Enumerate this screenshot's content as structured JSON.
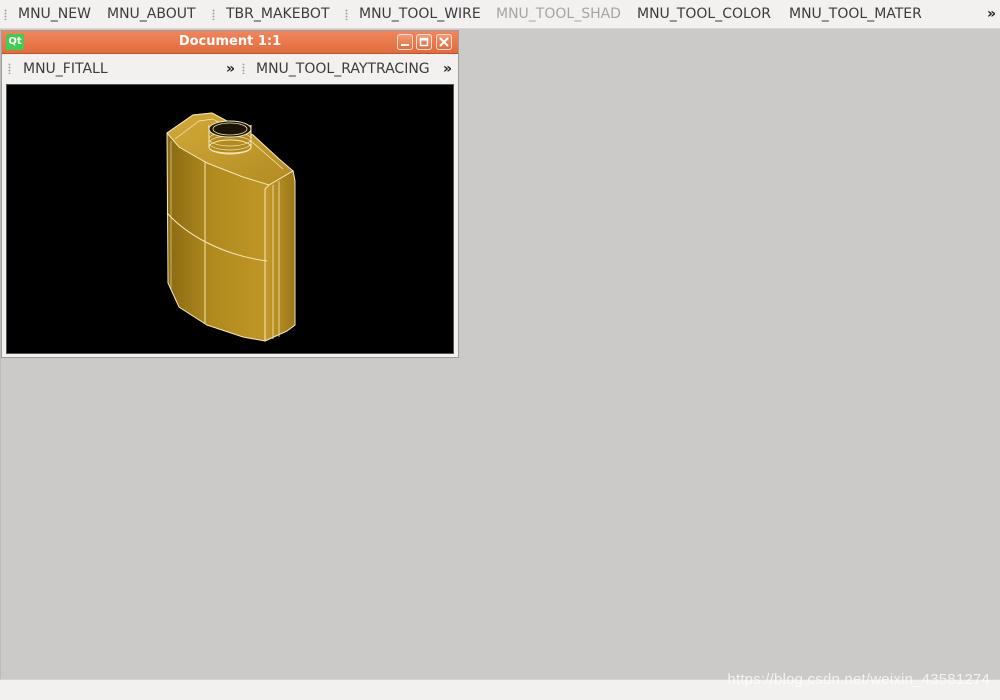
{
  "main_toolbar": {
    "items": [
      {
        "label": "MNU_NEW",
        "enabled": true
      },
      {
        "label": "MNU_ABOUT",
        "enabled": true
      },
      {
        "label": "TBR_MAKEBOT",
        "enabled": true
      },
      {
        "label": "MNU_TOOL_WIRE",
        "enabled": true
      },
      {
        "label": "MNU_TOOL_SHAD",
        "enabled": false
      },
      {
        "label": "MNU_TOOL_COLOR",
        "enabled": true
      },
      {
        "label": "MNU_TOOL_MATER",
        "enabled": true
      }
    ],
    "extension_glyph": "»"
  },
  "document_window": {
    "logo_text": "Qt",
    "title": "Document 1:1",
    "buttons": [
      "minimize-icon",
      "maximize-icon",
      "close-icon"
    ],
    "toolbar": {
      "items": [
        {
          "label": "MNU_FITALL"
        },
        {
          "label": "MNU_TOOL_RAYTRACING"
        }
      ],
      "extension_glyph": "»"
    },
    "viewport": {
      "background": "#000000",
      "model": "flask-shape",
      "shading_color": "#b8901e",
      "edge_color": "#ffffff"
    }
  },
  "colors": {
    "titlebar": "#e8733f",
    "workspace": "#cbcac9",
    "toolbar_bg": "#f2f1f0"
  },
  "watermark": "https://blog.csdn.net/weixin_43581274"
}
